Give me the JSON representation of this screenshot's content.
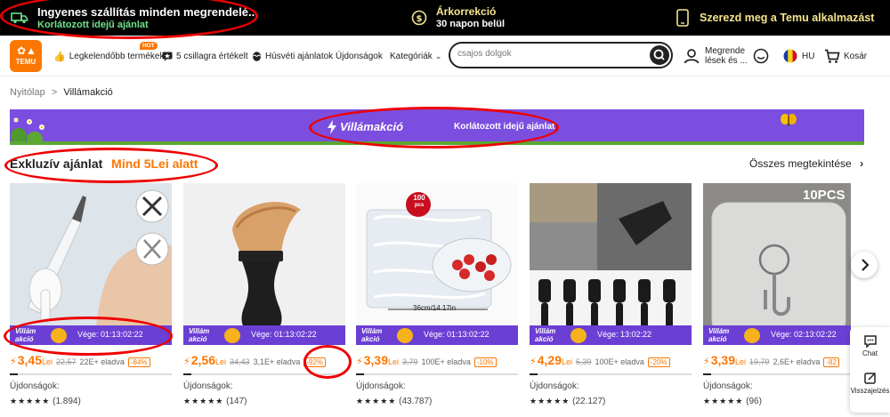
{
  "promo": {
    "shipping_title": "Ingyenes szállítás minden megrendelé...",
    "shipping_sub": "Korlátozott idejű ajánlat",
    "price_title": "Árkorrekció",
    "price_sub": "30 napon belül",
    "app_text": "Szerezd meg a Temu alkalmazást"
  },
  "nav": {
    "logo_text": "TEMU",
    "hot_badge": "HOT",
    "items": [
      {
        "label": "Legkelendőbb termékek",
        "icon": "thumbs-up-icon"
      },
      {
        "label": "5 csillagra értékelt",
        "icon": "star-badge-icon"
      },
      {
        "label": "Húsvéti ajánlatok",
        "icon": "easter-egg-icon"
      },
      {
        "label": "Újdonságok",
        "icon": ""
      },
      {
        "label": "Kategóriák",
        "icon": "chevron-down-icon"
      }
    ],
    "search_placeholder": "csajos dolgok",
    "orders_label_1": "Megrende",
    "orders_label_2": "lések és ...",
    "lang": "HU",
    "cart": "Kosár"
  },
  "breadcrumb": {
    "home": "Nyitólap",
    "sep": ">",
    "current": "Villámakció"
  },
  "banner": {
    "title": "Villámakció",
    "subtitle": "Korlátozott idejű ajánlat"
  },
  "section": {
    "title": "Exkluzív ajánlat",
    "highlight": "Mind 5Lei alatt",
    "see_all": "Összes megtekintése"
  },
  "flash_label_1": "Villám",
  "flash_label_2": "akció",
  "timer_prefix": "Vége: ",
  "new_label": "Újdonságok:",
  "products": [
    {
      "timer": "01:13:02:22",
      "price": "3,45",
      "currency": "Lei",
      "old": "22,57",
      "sold": "22E+ eladva",
      "discount": "-84%",
      "reviews": "(1.894)",
      "progress": 0.05,
      "stars": 5
    },
    {
      "timer": "01:13:02:22",
      "price": "2,56",
      "currency": "Lei",
      "old": "34,43",
      "sold": "3,1E+ eladva",
      "discount": "-92%",
      "reviews": "(147)",
      "progress": 0.05,
      "stars": 4.5
    },
    {
      "timer": "01:13:02:22",
      "price": "3,39",
      "currency": "Lei",
      "old": "3,79",
      "sold": "100E+ eladva",
      "discount": "-10%",
      "reviews": "(43.787)",
      "progress": 0.05,
      "stars": 4.5
    },
    {
      "timer": "13:02:22",
      "price": "4,29",
      "currency": "Lei",
      "old": "5,39",
      "sold": "100E+ eladva",
      "discount": "-20%",
      "reviews": "(22.127)",
      "progress": 0.05,
      "stars": 4.5
    },
    {
      "timer": "02:13:02:22",
      "price": "3,39",
      "currency": "Lei",
      "old": "19,79",
      "sold": "2,6E+ eladva",
      "discount": "-82",
      "reviews": "(96)",
      "progress": 0.05,
      "stars": 4.5
    }
  ],
  "product_images": [
    {
      "caption": ""
    },
    {
      "caption": ""
    },
    {
      "caption": "36cm/14.17in",
      "badge_1": "100",
      "badge_2": "pcs"
    },
    {
      "caption": ""
    },
    {
      "caption": "10PCS"
    }
  ],
  "side": {
    "chat": "Chat",
    "feedback": "Visszajelzés"
  },
  "colors": {
    "accent": "#fb7701",
    "flash_purple": "#6b3fd4",
    "banner_purple": "#7b4ee0",
    "annotation_red": "#e00000"
  }
}
